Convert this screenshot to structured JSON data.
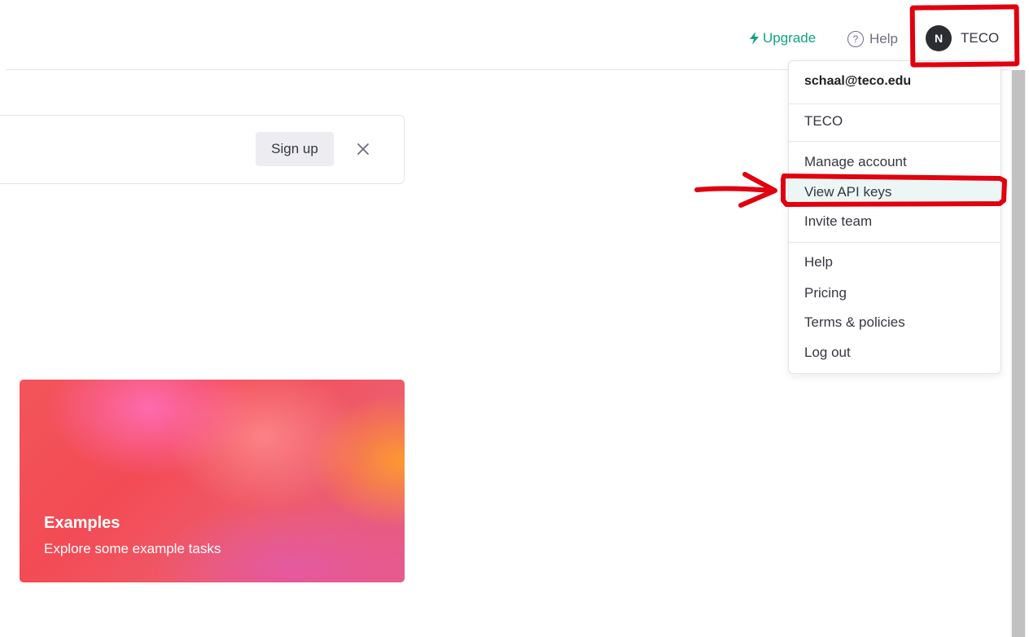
{
  "header": {
    "upgrade_label": "Upgrade",
    "help_label": "Help",
    "help_icon_glyph": "?",
    "account": {
      "avatar_initial": "N",
      "name": "TECO"
    }
  },
  "account_menu": {
    "email": "schaal@teco.edu",
    "organization": "TECO",
    "items_group1": [
      {
        "label": "Manage account",
        "highlighted": false
      },
      {
        "label": "View API keys",
        "highlighted": true
      },
      {
        "label": "Invite team",
        "highlighted": false
      }
    ],
    "items_group2": [
      {
        "label": "Help"
      },
      {
        "label": "Pricing"
      },
      {
        "label": "Terms & policies"
      },
      {
        "label": "Log out"
      }
    ]
  },
  "banner": {
    "signup_label": "Sign up",
    "close_icon": "close-icon"
  },
  "examples_card": {
    "title": "Examples",
    "description": "Explore some example tasks"
  },
  "colors": {
    "accent": "#10a37f",
    "annotation": "#e0000f",
    "highlight_bg": "#ecf7f5"
  }
}
